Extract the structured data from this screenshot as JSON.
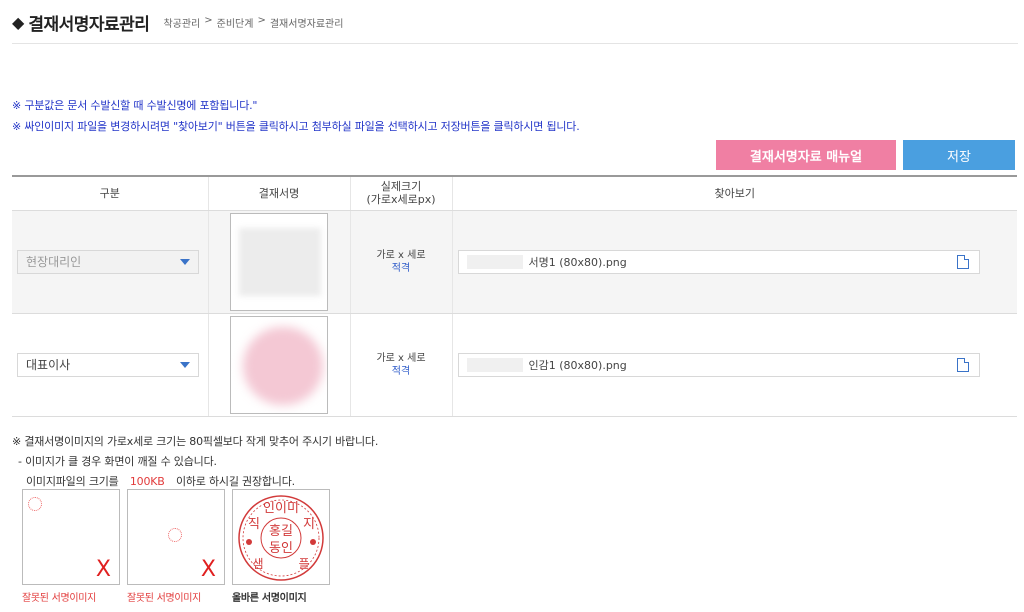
{
  "header": {
    "title": "결재서명자료관리",
    "breadcrumb": [
      "착공관리",
      "준비단계",
      "결재서명자료관리"
    ],
    "separator": ">"
  },
  "notices": [
    "※ 구분값은 문서 수발신할 때 수발신명에 포함됩니다.\"",
    "※ 싸인이미지 파일을 변경하시려면 \"찾아보기\" 버튼을 클릭하시고 첨부하실 파일을 선택하시고 저장버튼을 클릭하시면 됩니다."
  ],
  "buttons": {
    "manual": "결재서명자료 매뉴얼",
    "save": "저장"
  },
  "table": {
    "headers": {
      "type": "구분",
      "signature": "결재서명",
      "size_line1": "실제크기",
      "size_line2": "(가로x세로px)",
      "browse": "찾아보기"
    },
    "rows": [
      {
        "type": "현장대리인",
        "size_label": "가로 x 세로",
        "size_status": "적격",
        "file": "서명1 (80x80).png"
      },
      {
        "type": "대표이사",
        "size_label": "가로 x 세로",
        "size_status": "적격",
        "file": "인감1 (80x80).png"
      }
    ]
  },
  "guide": {
    "line1": "※ 결재서명이미지의 가로x세로 크기는 80픽셀보다 작게 맞추어 주시기 바랍니다.",
    "line2": "- 이미지가 클 경우 화면이 깨질 수 있습니다.",
    "line3_pre": "이미지파일의 크기를",
    "line3_size": "100KB",
    "line3_post": "이하로 하시길 권장합니다."
  },
  "examples": [
    {
      "caption": "잘못된 서명이미지",
      "mark": "X"
    },
    {
      "caption": "잘못된 서명이미지",
      "mark": "X"
    },
    {
      "caption": "올바른 서명이미지"
    }
  ],
  "seal": {
    "top": "인이미",
    "left": "직",
    "right": "지",
    "center1": "홍길",
    "center2": "동인",
    "bottom_left": "샘",
    "bottom_right": "플"
  },
  "colors": {
    "accent_pink": "#f07fa3",
    "accent_blue": "#4a9fe0",
    "notice_blue": "#2234c8",
    "error_red": "#e23c3c"
  }
}
